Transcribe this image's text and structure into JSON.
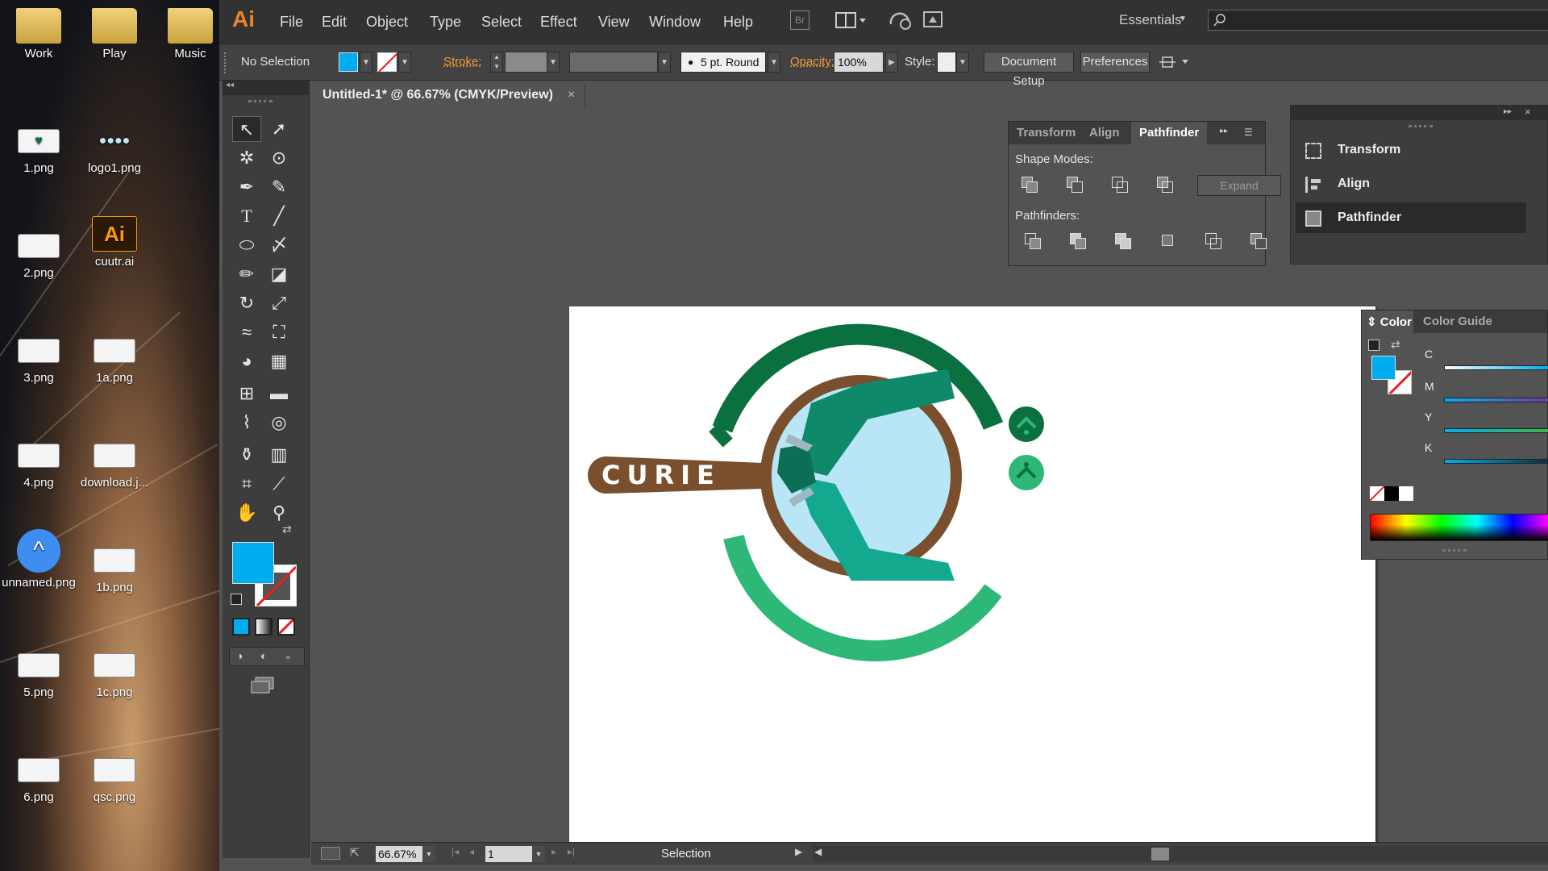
{
  "desktop": {
    "icons": [
      {
        "label": "Work",
        "kind": "folder"
      },
      {
        "label": "Play",
        "kind": "folder"
      },
      {
        "label": "Music",
        "kind": "folder"
      },
      {
        "label": "1.png",
        "kind": "image"
      },
      {
        "label": "logo1.png",
        "kind": "image"
      },
      {
        "label": "2.png",
        "kind": "image"
      },
      {
        "label": "cuutr.ai",
        "kind": "illustrator-file",
        "badge": "Ai"
      },
      {
        "label": "3.png",
        "kind": "image"
      },
      {
        "label": "1a.png",
        "kind": "image"
      },
      {
        "label": "4.png",
        "kind": "image"
      },
      {
        "label": "download.j...",
        "kind": "image"
      },
      {
        "label": "unnamed.png",
        "kind": "image"
      },
      {
        "label": "1b.png",
        "kind": "image"
      },
      {
        "label": "5.png",
        "kind": "image"
      },
      {
        "label": "1c.png",
        "kind": "image"
      },
      {
        "label": "6.png",
        "kind": "image"
      },
      {
        "label": "qsc.png",
        "kind": "image"
      }
    ]
  },
  "app": {
    "logo": "Ai",
    "menu": [
      "File",
      "Edit",
      "Object",
      "Type",
      "Select",
      "Effect",
      "View",
      "Window",
      "Help"
    ],
    "bridge_label": "Br",
    "workspace": "Essentials",
    "search_placeholder": ""
  },
  "control_bar": {
    "selection_label": "No Selection",
    "stroke_label": "Stroke:",
    "brush_label": "5 pt. Round",
    "opacity_label": "Opacity:",
    "opacity_value": "100%",
    "style_label": "Style:",
    "document_setup": "Document Setup",
    "preferences": "Preferences"
  },
  "document": {
    "tab_title": "Untitled-1* @ 66.67% (CMYK/Preview)",
    "close_glyph": "×"
  },
  "artwork": {
    "logo_text": "CURIE",
    "colors": {
      "dark_green": "#0b7040",
      "light_green": "#2db877",
      "brown": "#7a4f2e",
      "light_blue": "#b8e6f6",
      "teal": "#14a98e"
    }
  },
  "pathfinder_panel": {
    "tabs": [
      "Transform",
      "Align",
      "Pathfinder"
    ],
    "active_tab": "Pathfinder",
    "shape_modes_label": "Shape Modes:",
    "expand_label": "Expand",
    "pathfinders_label": "Pathfinders:"
  },
  "dock": {
    "items": [
      "Transform",
      "Align",
      "Pathfinder"
    ],
    "active": "Pathfinder"
  },
  "color_panel": {
    "tabs": [
      "Color",
      "Color Guide"
    ],
    "active_tab": "Color",
    "channels": [
      "C",
      "M",
      "Y",
      "K"
    ],
    "fill_color": "#00aeef"
  },
  "status": {
    "zoom": "66.67%",
    "artboard_number": "1",
    "tool_name": "Selection"
  }
}
